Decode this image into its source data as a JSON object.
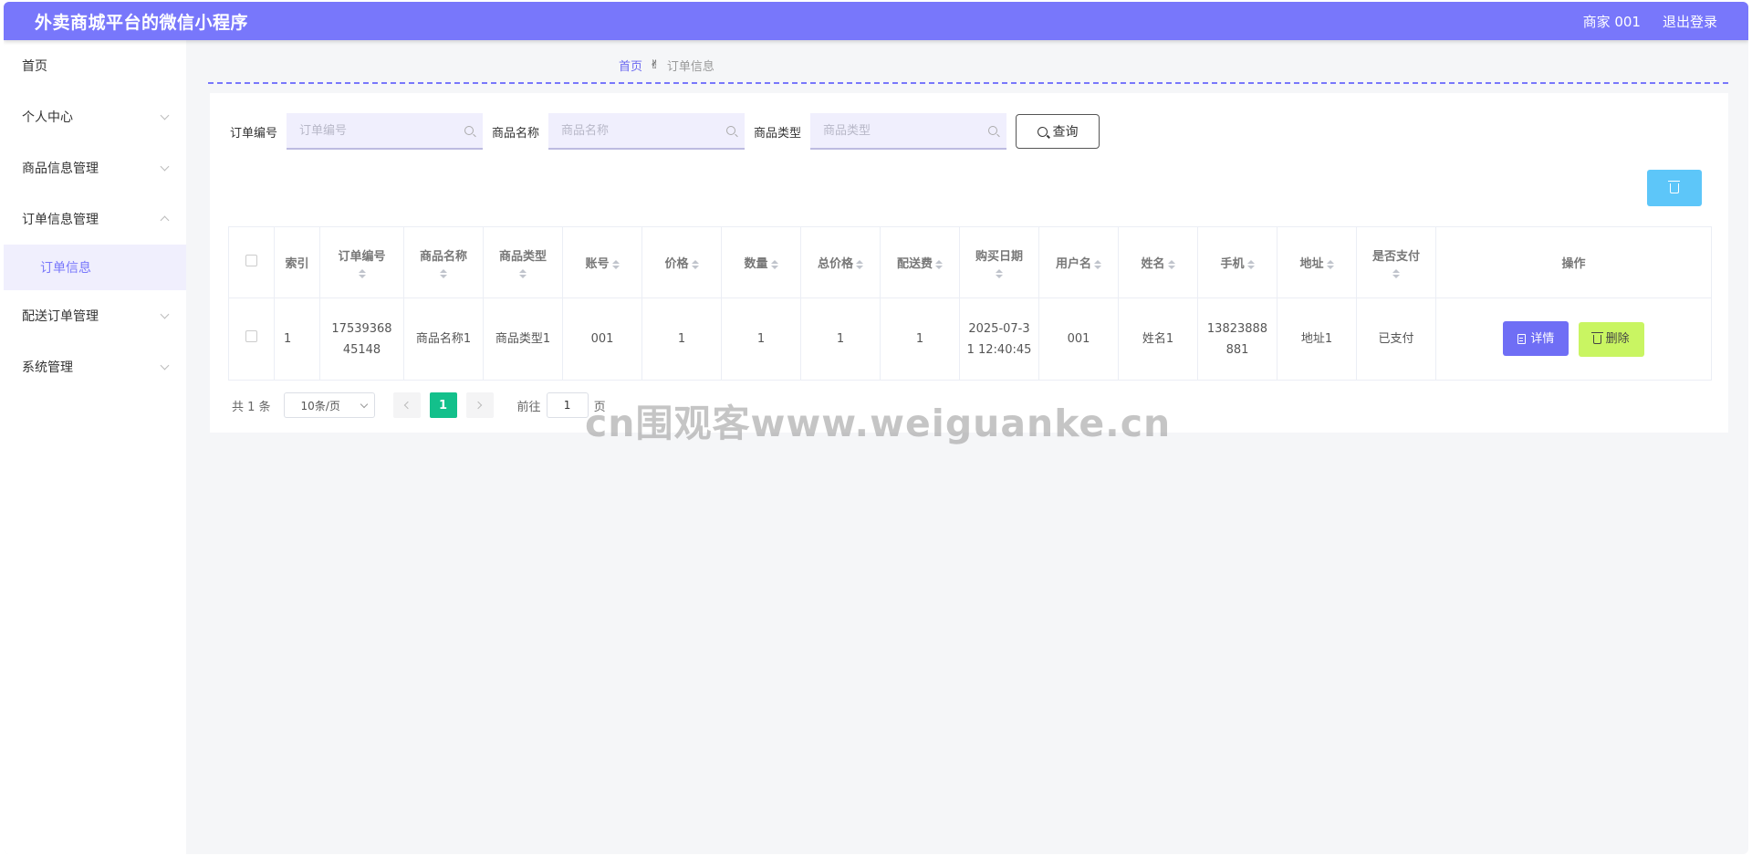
{
  "header": {
    "title": "外卖商城平台的微信小程序",
    "user": "商家 001",
    "logout": "退出登录"
  },
  "sidebar": {
    "items": [
      {
        "label": "首页"
      },
      {
        "label": "个人中心"
      },
      {
        "label": "商品信息管理"
      },
      {
        "label": "订单信息管理"
      },
      {
        "label": "配送订单管理"
      },
      {
        "label": "系统管理"
      }
    ],
    "subitem": "订单信息"
  },
  "breadcrumb": {
    "home": "首页",
    "icon": "✌",
    "current": "订单信息"
  },
  "search": {
    "order_no_label": "订单编号",
    "order_no_placeholder": "订单编号",
    "product_name_label": "商品名称",
    "product_name_placeholder": "商品名称",
    "product_type_label": "商品类型",
    "product_type_placeholder": "商品类型",
    "query_label": "查询"
  },
  "table": {
    "headers": [
      "索引",
      "订单编号",
      "商品名称",
      "商品类型",
      "账号",
      "价格",
      "数量",
      "总价格",
      "配送费",
      "购买日期",
      "用户名",
      "姓名",
      "手机",
      "地址",
      "是否支付",
      "操作"
    ],
    "rows": [
      {
        "index": "1",
        "order_no": "17539368 45148",
        "product_name": "商品名称1",
        "product_type": "商品类型1",
        "account": "001",
        "price": "1",
        "quantity": "1",
        "total": "1",
        "delivery_fee": "1",
        "date": "2025-07-31 12:40:45",
        "username": "001",
        "name": "姓名1",
        "phone": "13823888881",
        "address": "地址1",
        "paid": "已支付",
        "detail_label": "详情",
        "delete_label": "删除"
      }
    ]
  },
  "pager": {
    "total": "共 1 条",
    "page_size": "10条/页",
    "current_page": "1",
    "goto_label": "前往",
    "goto_value": "1",
    "page_unit": "页"
  },
  "watermark": "cn围观客www.weiguanke.cn",
  "colors": {
    "header": "#7877fb",
    "accent": "#7877fb",
    "detail_button": "#6f6ef5",
    "delete_button": "#c9f562",
    "batch_delete": "#5dc6f9",
    "page_active": "#13c08b"
  }
}
